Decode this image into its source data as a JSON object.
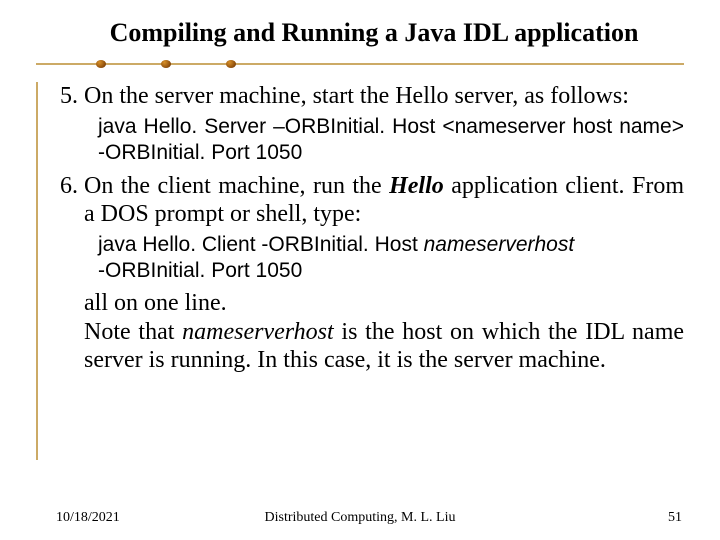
{
  "title": "Compiling and Running a Java IDL application",
  "list_start": 5,
  "items": [
    {
      "text": "On the server machine, start the Hello server, as follows:",
      "code": "java Hello. Server –ORBInitial. Host <nameserver host name> -ORBInitial. Port 1050"
    },
    {
      "pre": "On the client machine, run the ",
      "em": "Hello",
      "post": " application client. From a DOS prompt or shell, type:",
      "code_line1_pre": "java Hello. Client -ORBInitial. Host ",
      "code_line1_em": "nameserverhost",
      "code_line2": " -ORBInitial. Port 1050",
      "note_line1": "all on one line.",
      "note_line2_pre": "Note that ",
      "note_line2_em": "nameserverhost",
      "note_line2_post": " is the host on which the IDL name server is running. In this case, it is the server machine."
    }
  ],
  "footer": {
    "date": "10/18/2021",
    "center": "Distributed Computing, M. L. Liu",
    "page": "51"
  }
}
